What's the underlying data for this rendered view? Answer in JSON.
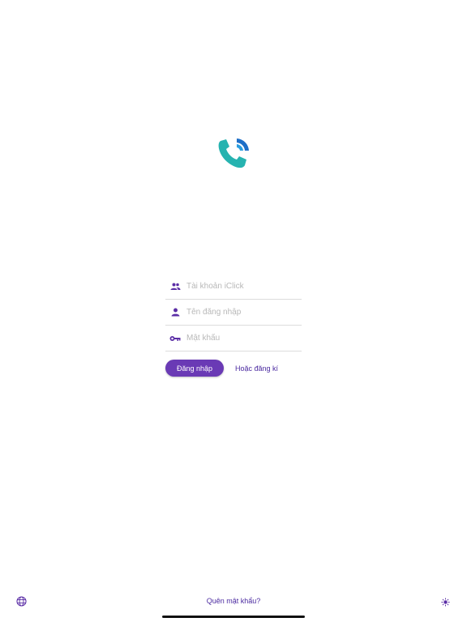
{
  "logo": {
    "icon": "phone-call-icon",
    "colors": {
      "handset": "#26b3b0",
      "wave_inner": "#2a9de0",
      "wave_outer": "#1e6fc8"
    }
  },
  "form": {
    "account_placeholder": "Tài khoản iClick",
    "username_placeholder": "Tên đăng nhập",
    "password_placeholder": "Mật khẩu",
    "icons": [
      "people-icon",
      "person-icon",
      "key-icon"
    ],
    "login_label": "Đăng nhập",
    "register_label": "Hoặc đăng kí"
  },
  "footer": {
    "language_icon": "globe-icon",
    "forgot_label": "Quên mật khẩu?",
    "theme_icon": "sun-icon"
  },
  "colors": {
    "primary": "#6a3ab5",
    "link": "#4b2aa0",
    "icon": "#5b2ea6"
  }
}
